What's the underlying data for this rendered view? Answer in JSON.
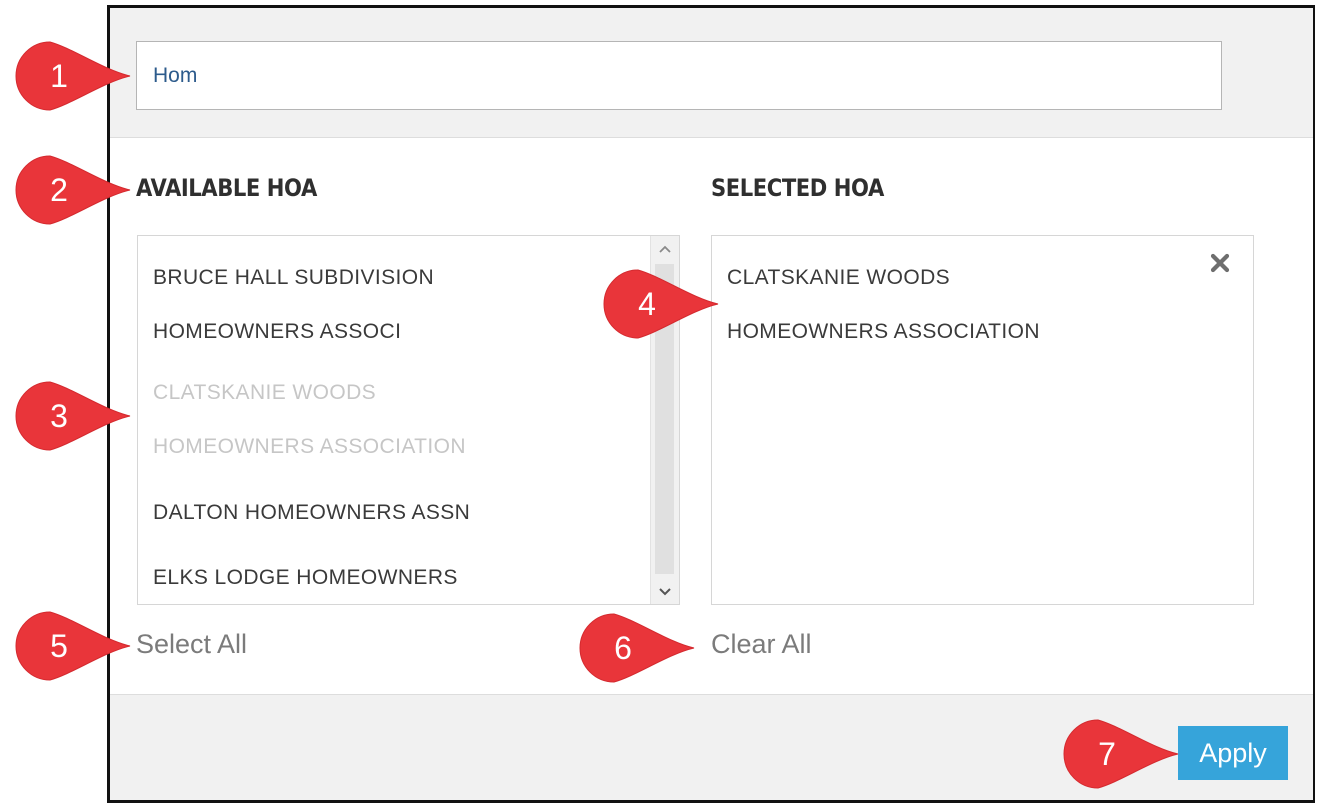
{
  "search": {
    "value": "Hom"
  },
  "available": {
    "heading": "AVAILABLE HOA",
    "items": [
      {
        "label": "BRUCE HALL SUBDIVISION"
      },
      {
        "label": "HOMEOWNERS ASSOCI"
      },
      {
        "label": "CLATSKANIE WOODS"
      },
      {
        "label": "HOMEOWNERS ASSOCIATION"
      },
      {
        "label": "DALTON HOMEOWNERS ASSN"
      },
      {
        "label": "ELKS LODGE HOMEOWNERS"
      }
    ],
    "select_all_label": "Select All"
  },
  "selected": {
    "heading": "SELECTED HOA",
    "items": [
      {
        "label": "CLATSKANIE WOODS"
      },
      {
        "label": "HOMEOWNERS ASSOCIATION"
      }
    ],
    "clear_all_label": "Clear All"
  },
  "footer": {
    "apply_label": "Apply"
  },
  "callouts": [
    "1",
    "2",
    "3",
    "4",
    "5",
    "6",
    "7"
  ],
  "icons": {
    "scroll_up": "chevron-up-icon",
    "scroll_down": "chevron-down-icon",
    "remove": "close-icon"
  },
  "colors": {
    "accent": "#36a4da",
    "callout": "#e9353a",
    "disabled_text": "#c6c6c6",
    "search_text": "#2d5b8c"
  }
}
